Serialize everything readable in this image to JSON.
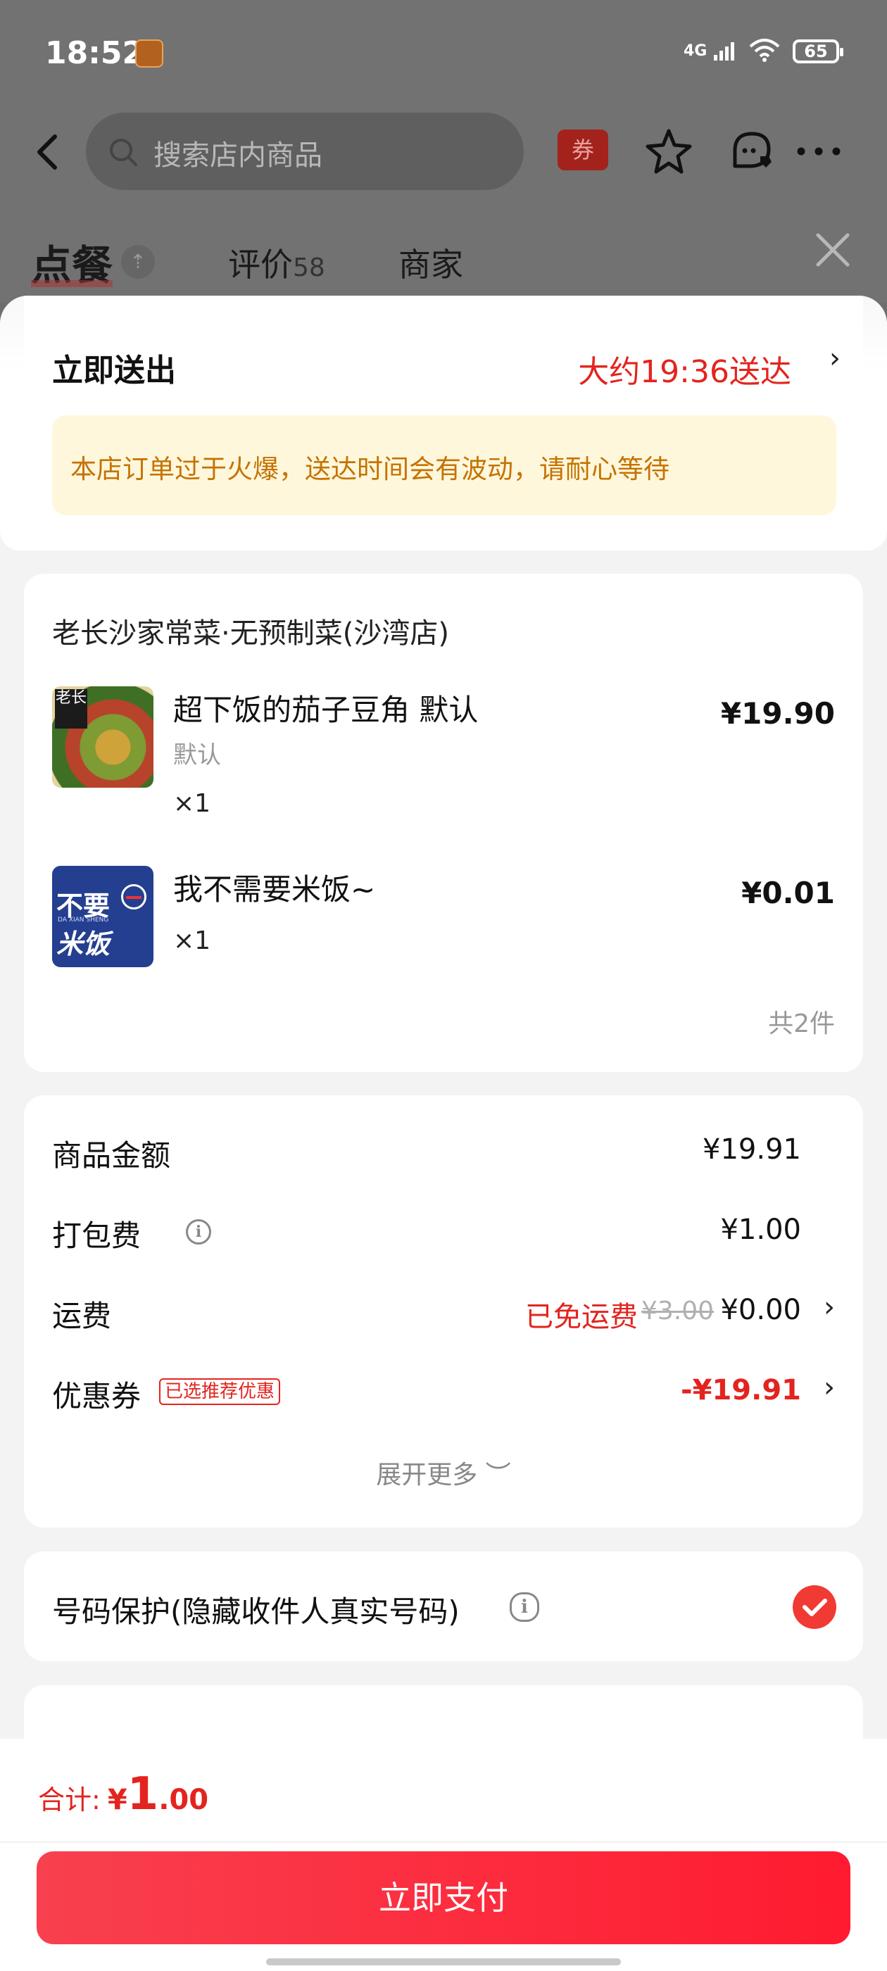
{
  "status_bar": {
    "time": "18:52",
    "network": "4G",
    "battery": "65",
    "icons": [
      "app-avatar-icon",
      "signal-icon",
      "wifi-icon",
      "battery-icon"
    ]
  },
  "header": {
    "search_placeholder": "搜索店内商品",
    "coupon_label": "券",
    "icons": [
      "back-icon",
      "search-icon",
      "coupon-icon",
      "star-icon",
      "customer-service-icon",
      "more-icon"
    ]
  },
  "tabs": {
    "order": "点餐",
    "reviews": "评价",
    "reviews_count": "58",
    "merchant": "商家"
  },
  "delivery": {
    "title": "立即送出",
    "eta": "大约19:36送达",
    "notice": "本店订单过于火爆，送达时间会有波动，请耐心等待"
  },
  "shop": {
    "name": "老长沙家常菜·无预制菜(沙湾店)",
    "items": [
      {
        "name": "超下饭的茄子豆角 默认",
        "spec": "默认",
        "qty": "×1",
        "price": "¥19.90",
        "image_tag": "老长"
      },
      {
        "name": "我不需要米饭~",
        "spec": "",
        "qty": "×1",
        "price": "¥0.01",
        "image_line1": "不要",
        "image_line2": "米饭",
        "image_small": "DA XIAN SHENG"
      }
    ],
    "count_text": "共2件"
  },
  "fees": {
    "goods_label": "商品金额",
    "goods_value": "¥19.91",
    "packing_label": "打包费",
    "packing_value": "¥1.00",
    "delivery_label": "运费",
    "delivery_free": "已免运费",
    "delivery_original": "¥3.00",
    "delivery_value": "¥0.00",
    "coupon_label": "优惠券",
    "coupon_badge": "已选推荐优惠",
    "coupon_value": "-¥19.91",
    "expand": "展开更多 ︶"
  },
  "privacy": {
    "text": "号码保护(隐藏收件人真实号码)",
    "checked": true
  },
  "footer": {
    "total_label": "合计:",
    "currency": "¥",
    "total_int": "1",
    "total_dec": ".00",
    "pay_button": "立即支付"
  },
  "colors": {
    "accent_red": "#e3241e",
    "notice_bg": "#fff7dc",
    "notice_text": "#c47300",
    "pay_gradient_start": "#f8404f",
    "pay_gradient_end": "#ff1b30"
  }
}
